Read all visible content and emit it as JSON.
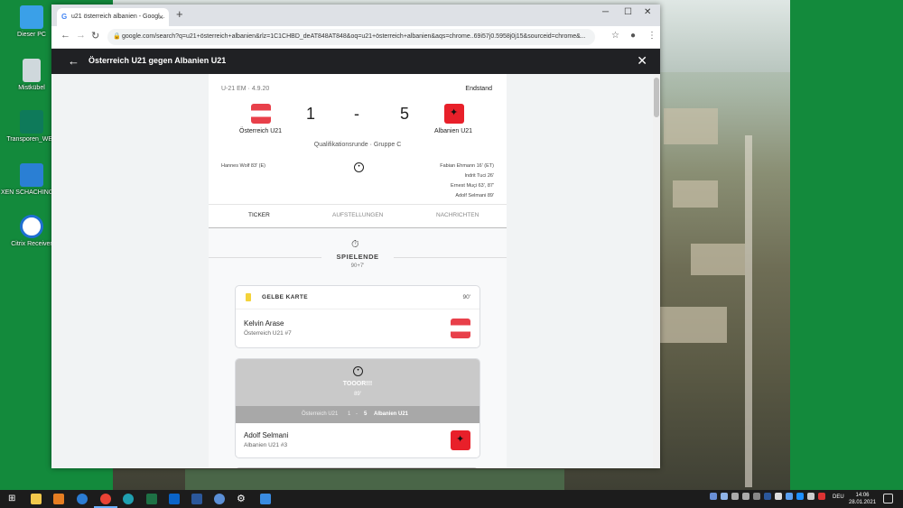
{
  "desktop": {
    "icons": [
      {
        "label": "Dieser PC"
      },
      {
        "label": "Mistkübel"
      },
      {
        "label": "Transporen_WEB"
      },
      {
        "label": "XEN SCHACHINGER"
      },
      {
        "label": "Citrix Receiver"
      }
    ]
  },
  "browser": {
    "tab_title": "u21 österreich albanien - Googl...",
    "tab_close": "×",
    "new_tab": "+",
    "url": "google.com/search?q=u21+österreich+albanien&rlz=1C1CHBD_deAT848AT848&oq=u21+österreich+albanien&aqs=chrome..69i57j0.5958j0j15&sourceid=chrome&..."
  },
  "overlay": {
    "title": "Österreich U21 gegen Albanien U21"
  },
  "match": {
    "competition": "U-21 EM · 4.9.20",
    "status": "Endstand",
    "home_team": "Österreich U21",
    "away_team": "Albanien U21",
    "home_score": "1",
    "separator": "-",
    "away_score": "5",
    "round": "Qualifikationsrunde · Gruppe C",
    "home_scorers": [
      "Hannes Wolf 83' (E)"
    ],
    "away_scorers": [
      "Fabian Ehmann 16' (ET)",
      "Indrit Tuci 26'",
      "Ernest Muçi 63', 87'",
      "Adolf Selmani 89'"
    ]
  },
  "tabs": [
    "TICKER",
    "AUFSTELLUNGEN",
    "NACHRICHTEN"
  ],
  "ticker": {
    "phase": "SPIELENDE",
    "phase_minute": "90+7'",
    "events": [
      {
        "type": "GELBE KARTE",
        "minute": "90'",
        "player": "Kelvin Arase",
        "team": "Österreich U21 #7"
      },
      {
        "type": "TOOOR!!!",
        "minute": "89'",
        "player": "Adolf Selmani",
        "team": "Albanien U21 #3",
        "score_home": "Österreich U21",
        "score_h": "1",
        "score_sep": "-",
        "score_a": "5",
        "score_away": "Albanien U21"
      }
    ]
  },
  "taskbar": {
    "language": "DEU",
    "time": "14:06",
    "date": "28.01.2021"
  },
  "colors": {
    "desktop_green": "#138a3c",
    "header_dark": "#202124",
    "austria_red": "#e8404a",
    "albania_red": "#e8202a",
    "yellow_card": "#f4d33a"
  }
}
